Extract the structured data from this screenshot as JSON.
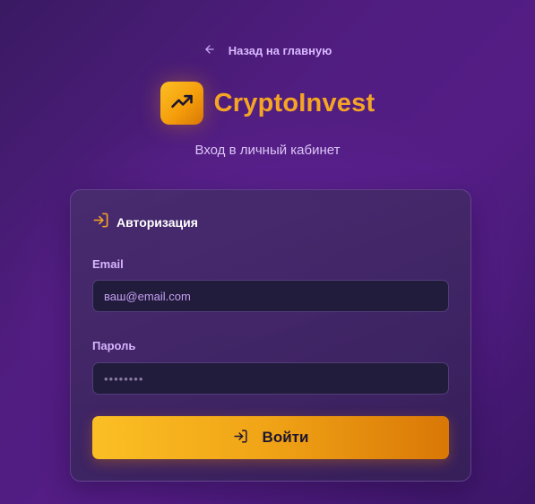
{
  "nav": {
    "back_label": "Назад на главную"
  },
  "brand": {
    "name": "CryptoInvest",
    "subtitle": "Вход в личный кабинет"
  },
  "card": {
    "title": "Авторизация",
    "email": {
      "label": "Email",
      "placeholder": "ваш@email.com"
    },
    "password": {
      "label": "Пароль",
      "placeholder": "••••••••"
    },
    "submit_label": "Войти"
  },
  "colors": {
    "accent": "#f59e0b",
    "background": "#501d7f",
    "label": "#d8b4fe"
  },
  "icons": {
    "back": "arrow-left-icon",
    "logo": "trending-up-icon",
    "login": "log-in-icon"
  }
}
